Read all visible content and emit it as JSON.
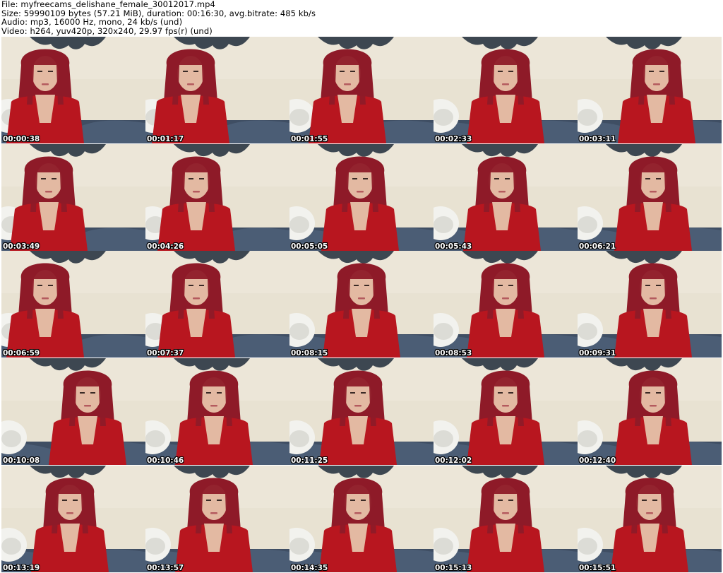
{
  "header": {
    "file_line": "File: myfreecams_delishane_female_30012017.mp4",
    "size_line": "Size: 59990109 bytes (57.21 MiB), duration: 00:16:30, avg.bitrate: 485 kb/s",
    "audio_line": "Audio: mp3, 16000 Hz, mono, 24 kb/s (und)",
    "video_line": "Video: h264, yuv420p, 320x240, 29.97 fps(r) (und)"
  },
  "thumbnails": [
    {
      "timestamp": "00:00:38"
    },
    {
      "timestamp": "00:01:17"
    },
    {
      "timestamp": "00:01:55"
    },
    {
      "timestamp": "00:02:33"
    },
    {
      "timestamp": "00:03:11"
    },
    {
      "timestamp": "00:03:49"
    },
    {
      "timestamp": "00:04:26"
    },
    {
      "timestamp": "00:05:05"
    },
    {
      "timestamp": "00:05:43"
    },
    {
      "timestamp": "00:06:21"
    },
    {
      "timestamp": "00:06:59"
    },
    {
      "timestamp": "00:07:37"
    },
    {
      "timestamp": "00:08:15"
    },
    {
      "timestamp": "00:08:53"
    },
    {
      "timestamp": "00:09:31"
    },
    {
      "timestamp": "00:10:08"
    },
    {
      "timestamp": "00:10:46"
    },
    {
      "timestamp": "00:11:25"
    },
    {
      "timestamp": "00:12:02"
    },
    {
      "timestamp": "00:12:40"
    },
    {
      "timestamp": "00:13:19"
    },
    {
      "timestamp": "00:13:57"
    },
    {
      "timestamp": "00:14:35"
    },
    {
      "timestamp": "00:15:13"
    },
    {
      "timestamp": "00:15:51"
    }
  ],
  "colors": {
    "wall": "#e8e2d2",
    "hair": "#8e1a28",
    "top": "#b8161f",
    "skin": "#e3b9a2",
    "bedding": "#3f4e63",
    "pillow": "#f2f2ee"
  }
}
